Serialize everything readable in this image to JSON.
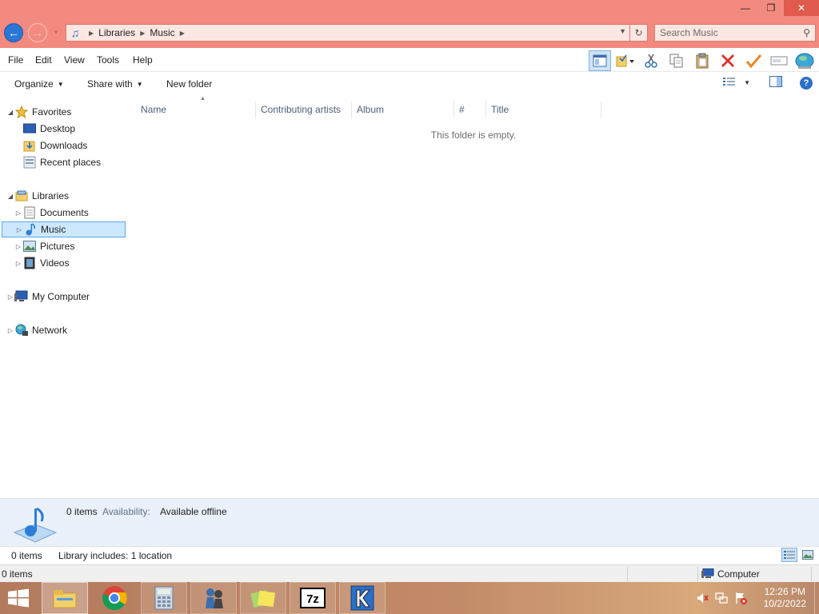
{
  "window": {
    "minimize": "—",
    "restore": "❐",
    "close": "✕"
  },
  "address": {
    "breadcrumbs": [
      "Libraries",
      "Music"
    ]
  },
  "search": {
    "placeholder": "Search Music"
  },
  "menu": {
    "items": [
      "File",
      "Edit",
      "View",
      "Tools",
      "Help"
    ]
  },
  "toolbar_icons": [
    "preview-pane-icon",
    "folder-options-icon",
    "cut-icon",
    "copy-icon",
    "paste-icon",
    "delete-icon",
    "check-icon",
    "rename-icon",
    "globe-icon"
  ],
  "commands": {
    "organize": "Organize",
    "share_with": "Share with",
    "new_folder": "New folder"
  },
  "nav": {
    "favorites": "Favorites",
    "desktop": "Desktop",
    "downloads": "Downloads",
    "recent_places": "Recent places",
    "libraries": "Libraries",
    "documents": "Documents",
    "music": "Music",
    "pictures": "Pictures",
    "videos": "Videos",
    "my_computer": "My Computer",
    "network": "Network"
  },
  "columns": [
    "Name",
    "Contributing artists",
    "Album",
    "#",
    "Title"
  ],
  "content": {
    "empty_message": "This folder is empty."
  },
  "details": {
    "item_count": "0 items",
    "availability_label": "Availability:",
    "availability_value": "Available offline"
  },
  "status_bar": {
    "items": "0 items",
    "library_includes": "Library includes: 1 location"
  },
  "status_bar_bottom": {
    "items": "0 items",
    "computer": "Computer"
  },
  "taskbar": {
    "apps": [
      "file-explorer",
      "chrome",
      "calculator",
      "chess",
      "sticky-notes",
      "7zip",
      "k-app"
    ],
    "time": "12:26 PM",
    "date": "10/2/2022"
  },
  "colors": {
    "titlebar": "#f28a80",
    "accent": "#2a77d6",
    "selection": "#cce8ff"
  }
}
